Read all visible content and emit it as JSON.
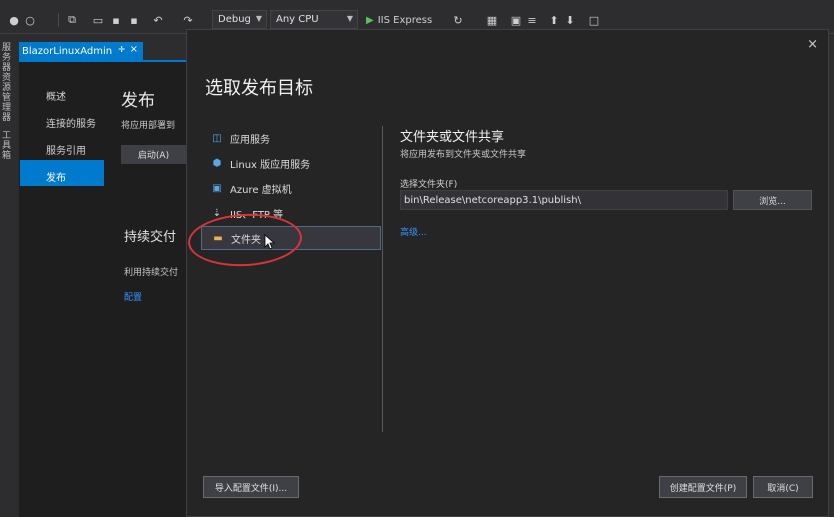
{
  "toolbar": {
    "configuration": "Debug",
    "platform": "Any CPU",
    "run_target": "IIS Express"
  },
  "side_strip": {
    "items": [
      "服务器资源管理器",
      "工具箱"
    ]
  },
  "document_tab": {
    "title": "BlazorLinuxAdmin"
  },
  "background_page": {
    "nav": [
      "概述",
      "连接的服务",
      "服务引用",
      "发布"
    ],
    "active_nav": "发布",
    "title": "发布",
    "subtitle": "将应用部署到",
    "start_button": "启动(A)",
    "cd_heading": "持续交付",
    "cd_text": "利用持续交付",
    "cd_link": "配置"
  },
  "dialog": {
    "title": "选取发布目标",
    "targets": [
      {
        "label": "应用服务",
        "icon": "app-service-icon",
        "color": "#59a7e8"
      },
      {
        "label": "Linux 版应用服务",
        "icon": "linux-app-service-icon",
        "color": "#59a7e8"
      },
      {
        "label": "Azure 虚拟机",
        "icon": "virtual-machine-icon",
        "color": "#59a7e8"
      },
      {
        "label": "IIS、FTP 等",
        "icon": "iis-ftp-icon",
        "color": "#cfcfcf"
      },
      {
        "label": "文件夹",
        "icon": "folder-icon",
        "color": "#e8b44c"
      }
    ],
    "selected_index": 4,
    "panel": {
      "title": "文件夹或文件共享",
      "subtitle": "将应用发布到文件夹或文件共享",
      "field_label": "选择文件夹(F)",
      "field_value": "bin\\Release\\netcoreapp3.1\\publish\\",
      "browse_button": "浏览...",
      "advanced_link": "高级..."
    },
    "import_button": "导入配置文件(I)...",
    "create_button": "创建配置文件(P)",
    "cancel_button": "取消(C)"
  },
  "colors": {
    "accent": "#007acc",
    "annotation": "#d8343a",
    "link": "#3794ff"
  }
}
